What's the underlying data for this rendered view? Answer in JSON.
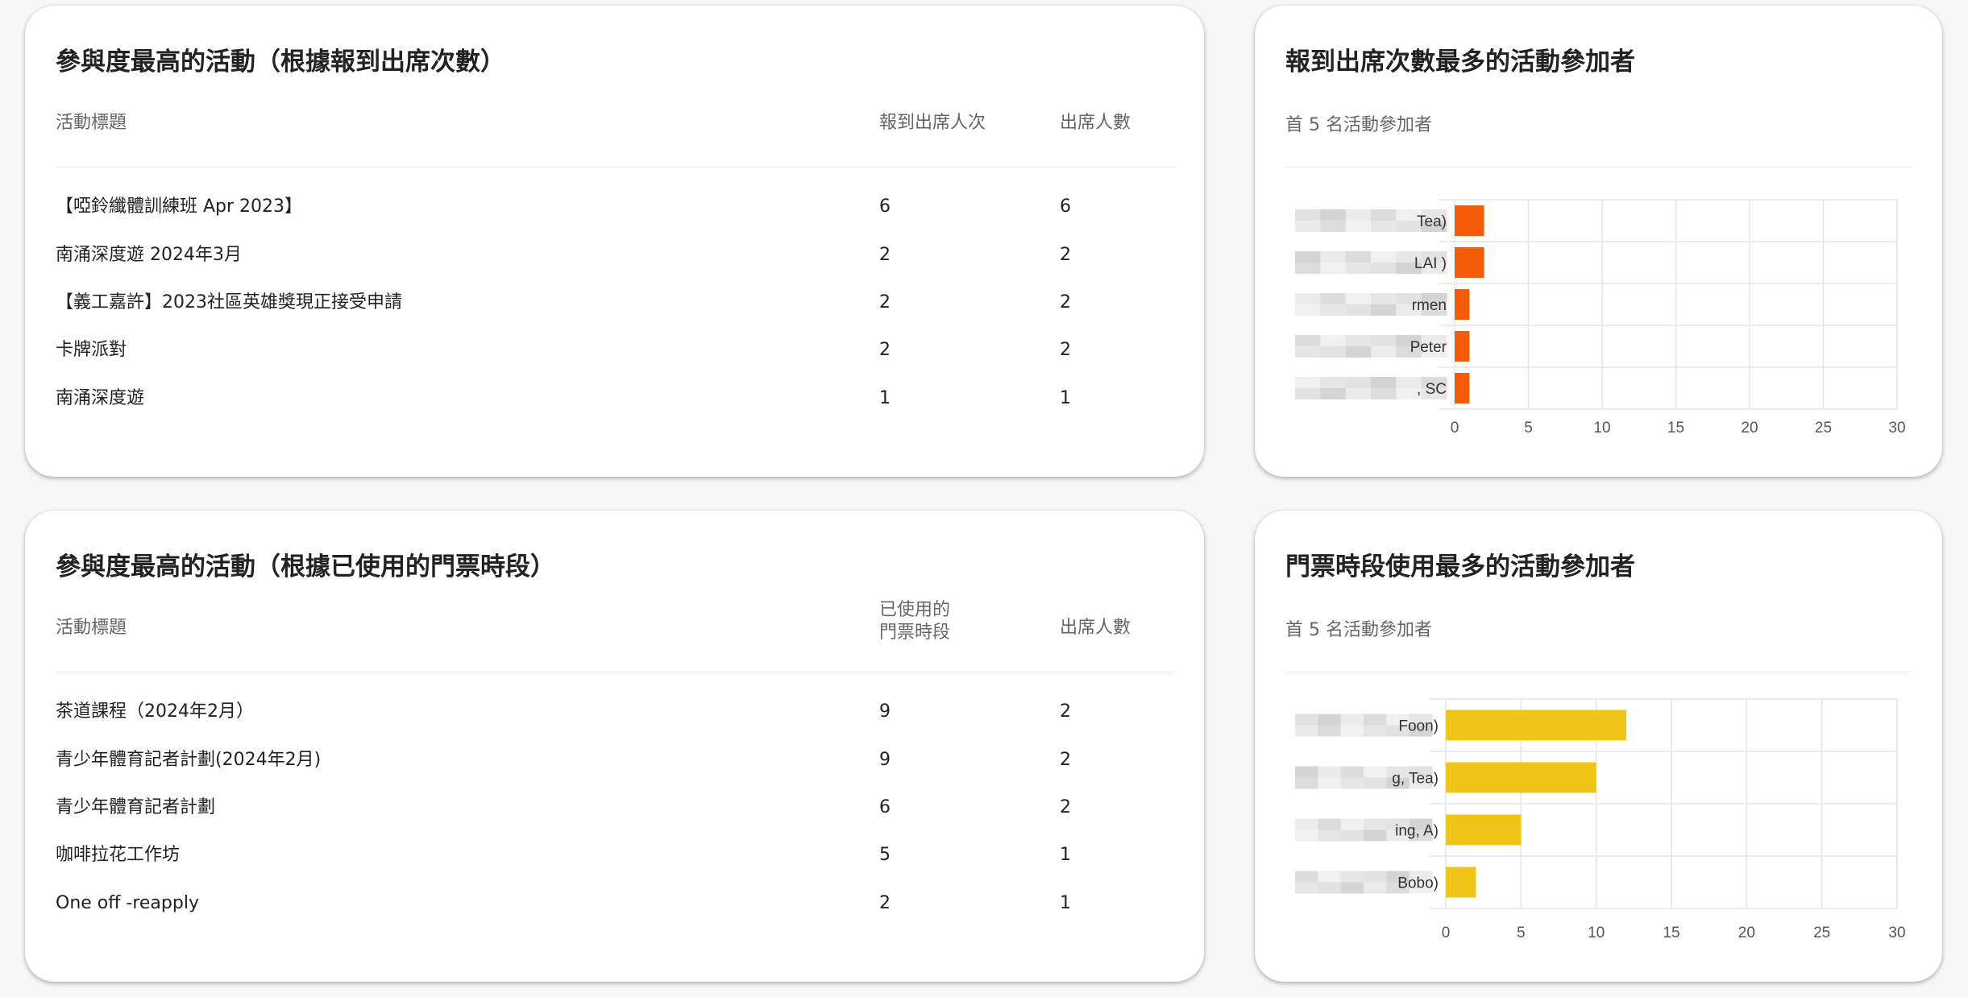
{
  "attendance_table": {
    "title": "參與度最高的活動（根據報到出席次數）",
    "col_title": "活動標題",
    "col_checkins": "報到出席人次",
    "col_attendees": "出席人數",
    "rows": [
      {
        "title": "【啞鈴纖體訓練班 Apr 2023】",
        "checkins": "6",
        "attendees": "6"
      },
      {
        "title": "南涌深度遊 2024年3月",
        "checkins": "2",
        "attendees": "2"
      },
      {
        "title": "【義工嘉許】2023社區英雄獎現正接受申請",
        "checkins": "2",
        "attendees": "2"
      },
      {
        "title": "卡牌派對",
        "checkins": "2",
        "attendees": "2"
      },
      {
        "title": "南涌深度遊",
        "checkins": "1",
        "attendees": "1"
      }
    ]
  },
  "ticket_table": {
    "title": "參與度最高的活動（根據已使用的門票時段）",
    "col_title": "活動標題",
    "col_slots_line1": "已使用的",
    "col_slots_line2": "門票時段",
    "col_attendees": "出席人數",
    "rows": [
      {
        "title": "茶道課程（2024年2月）",
        "slots": "9",
        "attendees": "2"
      },
      {
        "title": "青少年體育記者計劃(2024年2月)",
        "slots": "9",
        "attendees": "2"
      },
      {
        "title": "青少年體育記者計劃",
        "slots": "6",
        "attendees": "2"
      },
      {
        "title": "咖啡拉花工作坊",
        "slots": "5",
        "attendees": "1"
      },
      {
        "title": "One off -reapply",
        "slots": "2",
        "attendees": "1"
      }
    ]
  },
  "attendance_chart_card": {
    "title": "報到出席次數最多的活動參加者",
    "subtitle": "首 5 名活動參加者"
  },
  "ticket_chart_card": {
    "title": "門票時段使用最多的活動參加者",
    "subtitle": "首 5 名活動參加者"
  },
  "chart_data": [
    {
      "type": "bar",
      "orientation": "horizontal",
      "categories": [
        "Tea)",
        "LAI )",
        "rmen",
        "Peter",
        ", SC"
      ],
      "values": [
        2,
        2,
        1,
        1,
        1
      ],
      "xlim": [
        0,
        30
      ],
      "xticks": [
        "0",
        "5",
        "10",
        "15",
        "20",
        "25",
        "30"
      ],
      "grid": true,
      "color": "#f55c0a"
    },
    {
      "type": "bar",
      "orientation": "horizontal",
      "categories": [
        "Foon)",
        "g, Tea)",
        "ing, A)",
        "Bobo)"
      ],
      "values": [
        12,
        10,
        5,
        2
      ],
      "xlim": [
        0,
        30
      ],
      "xticks": [
        "0",
        "5",
        "10",
        "15",
        "20",
        "25",
        "30"
      ],
      "grid": true,
      "color": "#f1c419"
    }
  ]
}
